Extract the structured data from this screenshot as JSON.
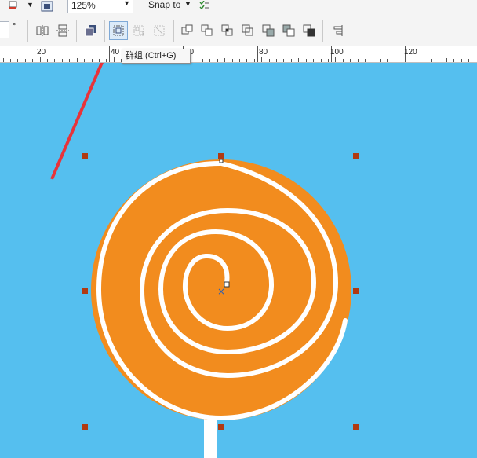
{
  "toolbar_top": {
    "zoom_value": "125%",
    "snap_label": "Snap to",
    "snap_arrow": "▼",
    "zoom_arrow": "▼"
  },
  "toolbar_bottom": {
    "degree_symbol": "°",
    "group_icon_name": "group-icon"
  },
  "ruler": {
    "labels": [
      "20",
      "40",
      "60",
      "80",
      "100",
      "120"
    ]
  },
  "tooltip": {
    "text": "群组 (Ctrl+G)"
  },
  "colors": {
    "canvas": "#55bfef",
    "lollipop": "#f28c1e",
    "swirl": "#ffffff",
    "handle": "#b03a12",
    "arrow": "#e8333a"
  }
}
